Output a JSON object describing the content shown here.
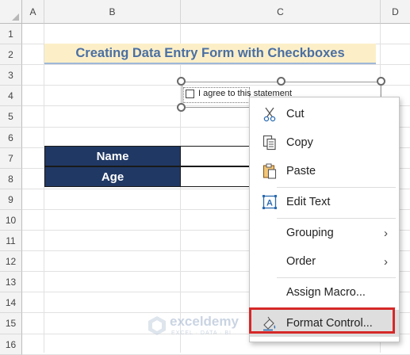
{
  "columns": [
    "A",
    "B",
    "C",
    "D"
  ],
  "rows": [
    "1",
    "2",
    "3",
    "4",
    "5",
    "6",
    "7",
    "8",
    "9",
    "10",
    "11",
    "12",
    "13",
    "14",
    "15",
    "16"
  ],
  "title": "Creating Data Entry Form with Checkboxes",
  "table": {
    "rows": [
      {
        "label": "Name",
        "value": ""
      },
      {
        "label": "Age",
        "value": ""
      }
    ]
  },
  "checkbox": {
    "label": "I agree to this statement",
    "checked": false
  },
  "context_menu": {
    "items": [
      {
        "label": "Cut",
        "icon": "scissors-icon"
      },
      {
        "label": "Copy",
        "icon": "copy-icon"
      },
      {
        "label": "Paste",
        "icon": "paste-icon"
      },
      {
        "label": "Edit Text",
        "icon": "edit-text-icon"
      },
      {
        "label": "Grouping",
        "submenu": true
      },
      {
        "label": "Order",
        "submenu": true
      },
      {
        "label": "Assign Macro..."
      },
      {
        "label": "Format Control...",
        "icon": "format-control-icon",
        "highlighted": true
      }
    ]
  },
  "watermark": {
    "name": "exceldemy",
    "tagline": "EXCEL · DATA · BI"
  },
  "colors": {
    "title_bg": "#fcefc8",
    "title_text": "#4a6fa3",
    "table_header": "#203864",
    "highlight_box": "#d62828"
  }
}
